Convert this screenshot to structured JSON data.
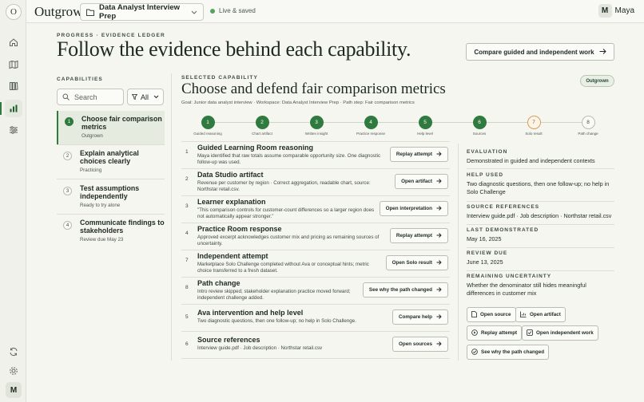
{
  "app": {
    "logo_letter": "O",
    "brand": "Outgrow",
    "workspace": "Data Analyst Interview Prep",
    "status": "Live & saved",
    "user_initial": "M",
    "user_name": "Maya",
    "rail_avatar": "M"
  },
  "header": {
    "eyebrow": "PROGRESS · EVIDENCE LEDGER",
    "title": "Follow the evidence behind each capability.",
    "compare_button": "Compare guided and independent work"
  },
  "capabilities": {
    "label": "CAPABILITIES",
    "search_placeholder": "Search",
    "filter_value": "All",
    "items": [
      {
        "num": "1",
        "title": "Choose fair comparison metrics",
        "sub": "Outgrown"
      },
      {
        "num": "2",
        "title": "Explain analytical choices clearly",
        "sub": "Practicing"
      },
      {
        "num": "3",
        "title": "Test assumptions independently",
        "sub": "Ready to try alone"
      },
      {
        "num": "4",
        "title": "Communicate findings to stakeholders",
        "sub": "Review due May 23"
      }
    ]
  },
  "selected": {
    "label": "SELECTED CAPABILITY",
    "title": "Choose and defend fair comparison metrics",
    "meta": "Goal: Junior data analyst interview · Workspace: Data Analyst Interview Prep · Path step: Fair comparison metrics",
    "tag": "Outgrown"
  },
  "steps": [
    {
      "num": "1",
      "label": "Guided reasoning",
      "state": "done"
    },
    {
      "num": "2",
      "label": "Chart artifact",
      "state": "done"
    },
    {
      "num": "3",
      "label": "Written insight",
      "state": "done"
    },
    {
      "num": "4",
      "label": "Practice response",
      "state": "done"
    },
    {
      "num": "5",
      "label": "Help level",
      "state": "done"
    },
    {
      "num": "6",
      "label": "Sources",
      "state": "done"
    },
    {
      "num": "7",
      "label": "Solo result",
      "state": "warn"
    },
    {
      "num": "8",
      "label": "Path change",
      "state": "plain"
    }
  ],
  "evidence": [
    {
      "num": "1",
      "title": "Guided Learning Room reasoning",
      "desc": "Maya identified that raw totals assume comparable opportunity size. One diagnostic follow-up was used.",
      "button": "Replay attempt"
    },
    {
      "num": "2",
      "title": "Data Studio artifact",
      "desc": "Revenue per customer by region · Correct aggregation, readable chart, source: Northstar retail.csv.",
      "button": "Open artifact"
    },
    {
      "num": "3",
      "title": "Learner explanation",
      "desc": "\"This comparison controls for customer-count differences so a larger region does not automatically appear stronger.\"",
      "button": "Open interpretation"
    },
    {
      "num": "4",
      "title": "Practice Room response",
      "desc": "Approved excerpt acknowledges customer mix and pricing as remaining sources of uncertainty.",
      "button": "Replay attempt"
    },
    {
      "num": "7",
      "title": "Independent attempt",
      "desc": "Marketplace Solo Challenge completed without Ava or conceptual hints; metric choice transferred to a fresh dataset.",
      "button": "Open Solo result"
    },
    {
      "num": "8",
      "title": "Path change",
      "desc": "Intro review skipped; stakeholder explanation practice moved forward; independent challenge added.",
      "button": "See why the path changed"
    },
    {
      "num": "5",
      "title": "Ava intervention and help level",
      "desc": "Two diagnostic questions, then one follow-up; no help in Solo Challenge.",
      "button": "Compare help"
    },
    {
      "num": "6",
      "title": "Source references",
      "desc": "Interview guide.pdf · Job description · Northstar retail.csv",
      "button": "Open sources"
    }
  ],
  "details": {
    "evaluation": {
      "key": "EVALUATION",
      "value": "Demonstrated in guided and independent contexts"
    },
    "help_used": {
      "key": "HELP USED",
      "value": "Two diagnostic questions, then one follow-up; no help in Solo Challenge"
    },
    "sources": {
      "key": "SOURCE REFERENCES",
      "value": "Interview guide.pdf · Job description · Northstar retail.csv"
    },
    "last_demonstrated": {
      "key": "LAST DEMONSTRATED",
      "value": "May 16, 2025"
    },
    "review_due": {
      "key": "REVIEW DUE",
      "value": "June 13, 2025"
    },
    "uncertainty": {
      "key": "REMAINING UNCERTAINTY",
      "value": "Whether the denominator still hides meaningful differences in customer mix"
    }
  },
  "actions": {
    "open_source": "Open source",
    "open_artifact": "Open artifact",
    "replay_attempt": "Replay attempt",
    "open_independent": "Open independent work",
    "see_why": "See why the path changed"
  }
}
